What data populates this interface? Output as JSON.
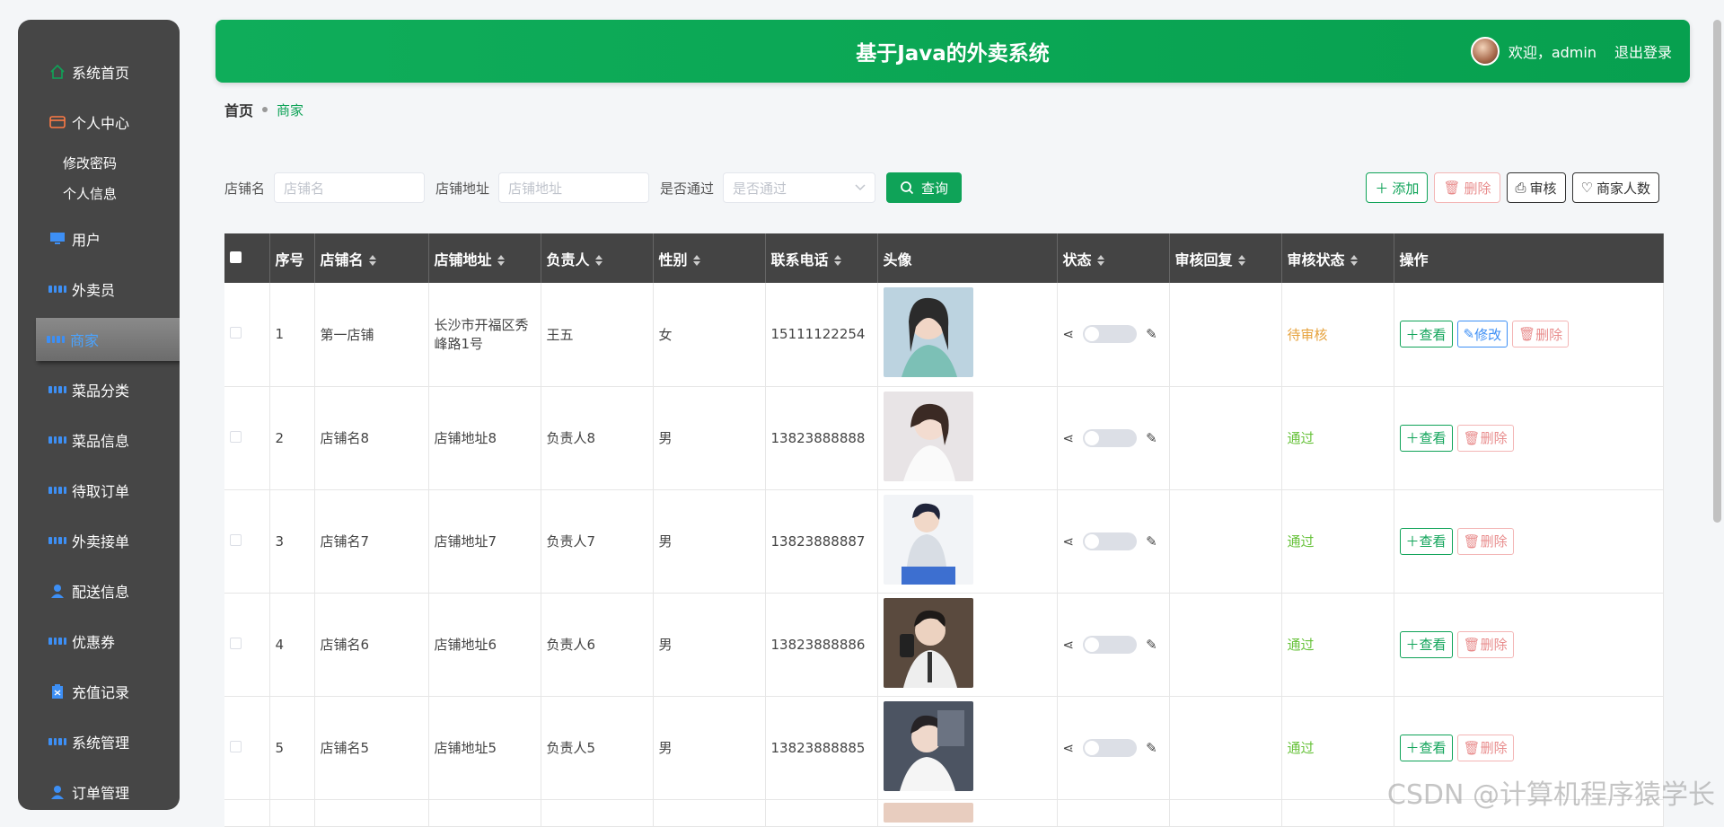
{
  "sidebar": {
    "items": [
      {
        "label": "系统首页",
        "icon": "home-icon"
      },
      {
        "label": "个人中心",
        "icon": "wallet-icon"
      },
      {
        "label": "修改密码"
      },
      {
        "label": "个人信息"
      },
      {
        "label": "用户",
        "icon": "monitor-icon"
      },
      {
        "label": "外卖员",
        "icon": "grid-icon"
      },
      {
        "label": "商家",
        "icon": "grid-icon"
      },
      {
        "label": "菜品分类",
        "icon": "grid-icon"
      },
      {
        "label": "菜品信息",
        "icon": "grid-icon"
      },
      {
        "label": "待取订单",
        "icon": "grid-icon"
      },
      {
        "label": "外卖接单",
        "icon": "grid-icon"
      },
      {
        "label": "配送信息",
        "icon": "person-icon"
      },
      {
        "label": "优惠券",
        "icon": "grid-icon"
      },
      {
        "label": "充值记录",
        "icon": "clipboard-icon"
      },
      {
        "label": "系统管理",
        "icon": "grid-icon"
      },
      {
        "label": "订单管理",
        "icon": "person-icon"
      }
    ]
  },
  "header": {
    "title": "基于Java的外卖系统",
    "welcome": "欢迎，admin",
    "logout": "退出登录"
  },
  "breadcrumb": {
    "home": "首页",
    "current": "商家"
  },
  "search": {
    "shop_label": "店铺名",
    "shop_placeholder": "店铺名",
    "addr_label": "店铺地址",
    "addr_placeholder": "店铺地址",
    "pass_label": "是否通过",
    "pass_placeholder": "是否通过",
    "button": "查询"
  },
  "actions": {
    "add": "添加",
    "delete": "删除",
    "audit": "审核",
    "count": "商家人数"
  },
  "table": {
    "headers": [
      "序号",
      "店铺名",
      "店铺地址",
      "负责人",
      "性别",
      "联系电话",
      "头像",
      "状态",
      "审核回复",
      "审核状态",
      "操作"
    ],
    "rows": [
      {
        "no": "1",
        "shop": "第一店铺",
        "addr": "长沙市开福区秀峰路1号",
        "owner": "王五",
        "gender": "女",
        "phone": "15111122254",
        "audit": "待审核"
      },
      {
        "no": "2",
        "shop": "店铺名8",
        "addr": "店铺地址8",
        "owner": "负责人8",
        "gender": "男",
        "phone": "13823888888",
        "audit": "通过"
      },
      {
        "no": "3",
        "shop": "店铺名7",
        "addr": "店铺地址7",
        "owner": "负责人7",
        "gender": "男",
        "phone": "13823888887",
        "audit": "通过"
      },
      {
        "no": "4",
        "shop": "店铺名6",
        "addr": "店铺地址6",
        "owner": "负责人6",
        "gender": "男",
        "phone": "13823888886",
        "audit": "通过"
      },
      {
        "no": "5",
        "shop": "店铺名5",
        "addr": "店铺地址5",
        "owner": "负责人5",
        "gender": "男",
        "phone": "13823888885",
        "audit": "通过"
      }
    ],
    "op_view": "查看",
    "op_edit": "修改",
    "op_delete": "删除"
  },
  "watermark": "CSDN @计算机程序猿学长"
}
